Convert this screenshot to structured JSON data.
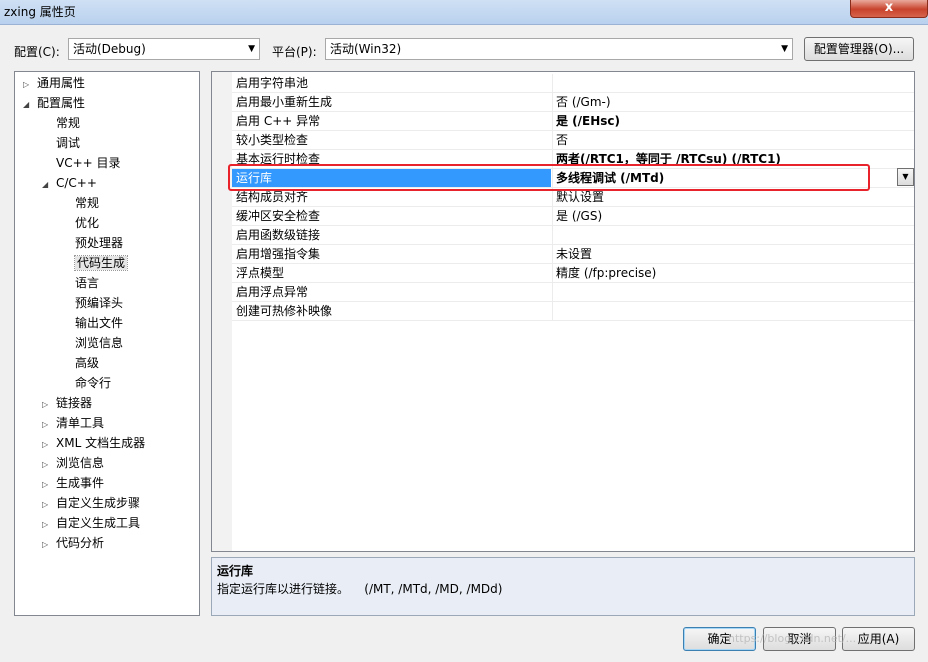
{
  "window": {
    "title": "zxing 属性页",
    "close_glyph": "x"
  },
  "toolbar": {
    "config_label": "配置(C):",
    "config_value": "活动(Debug)",
    "platform_label": "平台(P):",
    "platform_value": "活动(Win32)",
    "config_manager_label": "配置管理器(O)..."
  },
  "tree": [
    {
      "label": "通用属性",
      "level": 0,
      "expander": "▷"
    },
    {
      "label": "配置属性",
      "level": 0,
      "expander": "◢"
    },
    {
      "label": "常规",
      "level": 1,
      "expander": ""
    },
    {
      "label": "调试",
      "level": 1,
      "expander": ""
    },
    {
      "label": "VC++ 目录",
      "level": 1,
      "expander": ""
    },
    {
      "label": "C/C++",
      "level": 1,
      "expander": "◢"
    },
    {
      "label": "常规",
      "level": 2,
      "expander": ""
    },
    {
      "label": "优化",
      "level": 2,
      "expander": ""
    },
    {
      "label": "预处理器",
      "level": 2,
      "expander": ""
    },
    {
      "label": "代码生成",
      "level": 2,
      "expander": "",
      "selected": true
    },
    {
      "label": "语言",
      "level": 2,
      "expander": ""
    },
    {
      "label": "预编译头",
      "level": 2,
      "expander": ""
    },
    {
      "label": "输出文件",
      "level": 2,
      "expander": ""
    },
    {
      "label": "浏览信息",
      "level": 2,
      "expander": ""
    },
    {
      "label": "高级",
      "level": 2,
      "expander": ""
    },
    {
      "label": "命令行",
      "level": 2,
      "expander": ""
    },
    {
      "label": "链接器",
      "level": 1,
      "expander": "▷"
    },
    {
      "label": "清单工具",
      "level": 1,
      "expander": "▷"
    },
    {
      "label": "XML 文档生成器",
      "level": 1,
      "expander": "▷"
    },
    {
      "label": "浏览信息",
      "level": 1,
      "expander": "▷"
    },
    {
      "label": "生成事件",
      "level": 1,
      "expander": "▷"
    },
    {
      "label": "自定义生成步骤",
      "level": 1,
      "expander": "▷"
    },
    {
      "label": "自定义生成工具",
      "level": 1,
      "expander": "▷"
    },
    {
      "label": "代码分析",
      "level": 1,
      "expander": "▷"
    }
  ],
  "properties": [
    {
      "name": "启用字符串池",
      "value": ""
    },
    {
      "name": "启用最小重新生成",
      "value": "否 (/Gm-)"
    },
    {
      "name": "启用 C++ 异常",
      "value": "是 (/EHsc)",
      "bold": true
    },
    {
      "name": "较小类型检查",
      "value": "否"
    },
    {
      "name": "基本运行时检查",
      "value": "两者(/RTC1，等同于 /RTCsu) (/RTC1)",
      "bold": true
    },
    {
      "name": "运行库",
      "value": "多线程调试 (/MTd)",
      "selected": true
    },
    {
      "name": "结构成员对齐",
      "value": "默认设置"
    },
    {
      "name": "缓冲区安全检查",
      "value": "是 (/GS)"
    },
    {
      "name": "启用函数级链接",
      "value": ""
    },
    {
      "name": "启用增强指令集",
      "value": "未设置"
    },
    {
      "name": "浮点模型",
      "value": "精度 (/fp:precise)"
    },
    {
      "name": "启用浮点异常",
      "value": ""
    },
    {
      "name": "创建可热修补映像",
      "value": ""
    }
  ],
  "description": {
    "title": "运行库",
    "body": "指定运行库以进行链接。    (/MT, /MTd, /MD, /MDd)"
  },
  "buttons": {
    "ok": "确定",
    "cancel": "取消",
    "apply": "应用(A)"
  },
  "watermark": "https://blog.csdn.net/...",
  "colors": {
    "selection": "#3399ff",
    "highlight_box": "#e8232b"
  }
}
